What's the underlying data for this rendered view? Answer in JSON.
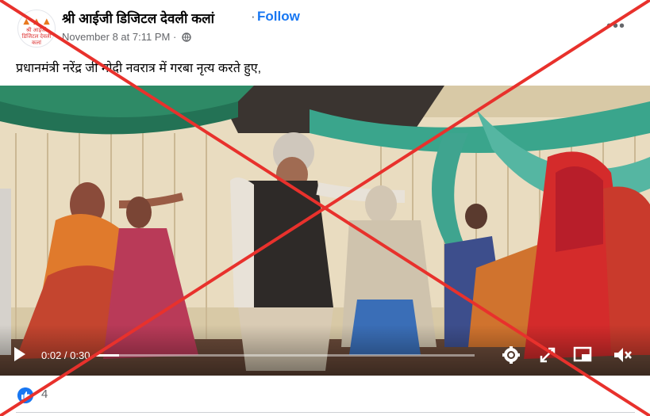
{
  "post": {
    "page_name": "श्री आईजी डिजिटल देवली कलां",
    "separator": "·",
    "follow_label": "Follow",
    "timestamp": "November 8 at 7:11 PM",
    "timestamp_sep": "·",
    "privacy_icon": "globe-icon",
    "more_icon": "more-horizontal-icon",
    "caption": "प्रधानमंत्री नरेंद्र जी मोदी नवरात्र में गरबा नृत्य करते हुए,"
  },
  "avatar": {
    "logo_text": "श्री आईजी डिजिटल देवली कलां"
  },
  "video": {
    "current_time": "0:02",
    "duration": "0:30",
    "time_separator": " / ",
    "progress_fraction": 0.067,
    "icons": [
      "play-icon",
      "settings-icon",
      "expand-icon",
      "picture-in-picture-icon",
      "volume-muted-icon"
    ]
  },
  "reactions": {
    "icon": "like-icon",
    "count": "4"
  },
  "colors": {
    "accent": "#1877f2",
    "cross": "#e8312c",
    "secondary_text": "#65676b"
  }
}
